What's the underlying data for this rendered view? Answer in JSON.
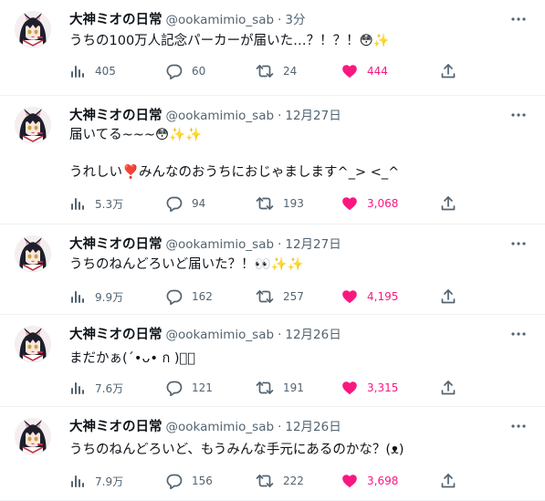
{
  "tweets": [
    {
      "author": "大神ミオの日常",
      "handle": "@ookamimio_sab",
      "separator": "·",
      "time": "3分",
      "lines": [
        "うちの100万人記念パーカーが届いた…？！？！😳✨"
      ],
      "views": "405",
      "replies": "60",
      "retweets": "24",
      "likes": "444"
    },
    {
      "author": "大神ミオの日常",
      "handle": "@ookamimio_sab",
      "separator": "·",
      "time": "12月27日",
      "lines": [
        "届いてる~~~😳✨✨",
        "",
        "うれしい❣️みんなのおうちにおじゃまします^_> <_^"
      ],
      "views": "5.3万",
      "replies": "94",
      "retweets": "193",
      "likes": "3,068"
    },
    {
      "author": "大神ミオの日常",
      "handle": "@ookamimio_sab",
      "separator": "·",
      "time": "12月27日",
      "lines": [
        "うちのねんどろいど届いた？！👀✨✨"
      ],
      "views": "9.9万",
      "replies": "162",
      "retweets": "257",
      "likes": "4,195"
    },
    {
      "author": "大神ミオの日常",
      "handle": "@ookamimio_sab",
      "separator": "·",
      "time": "12月26日",
      "lines": [
        "まだかぁ(´•ᴗ• ก )ﾟﾟ"
      ],
      "views": "7.6万",
      "replies": "121",
      "retweets": "191",
      "likes": "3,315"
    },
    {
      "author": "大神ミオの日常",
      "handle": "@ookamimio_sab",
      "separator": "·",
      "time": "12月26日",
      "lines": [
        "うちのねんどろいど、もうみんな手元にあるのかな？(ᴥ)"
      ],
      "views": "7.9万",
      "replies": "156",
      "retweets": "222",
      "likes": "3,698"
    }
  ],
  "icons": {
    "more": "more-dots-icon",
    "views": "views-chart-icon",
    "reply": "reply-bubble-icon",
    "retweet": "retweet-arrows-icon",
    "like": "heart-icon",
    "share": "share-upload-icon",
    "avatar": "wolf-girl-avatar"
  },
  "colors": {
    "text": "#0f1419",
    "secondary": "#536471",
    "like": "#f91880",
    "divider": "#eff3f4"
  }
}
